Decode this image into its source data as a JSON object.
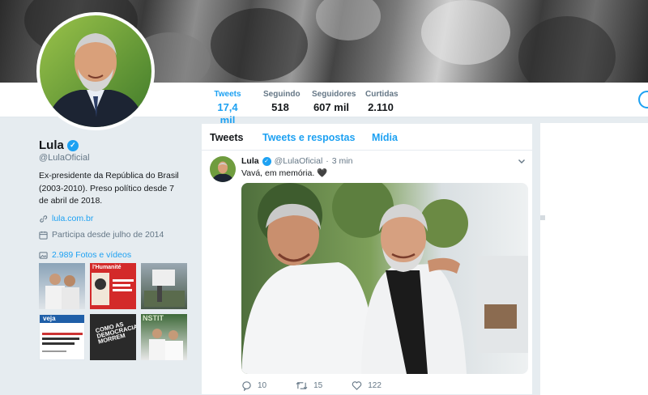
{
  "nav": {
    "stats": [
      {
        "label": "Tweets",
        "value": "17,4 mil",
        "active": true
      },
      {
        "label": "Seguindo",
        "value": "518"
      },
      {
        "label": "Seguidores",
        "value": "607 mil"
      },
      {
        "label": "Curtidas",
        "value": "2.110"
      }
    ]
  },
  "profile": {
    "name": "Lula",
    "handle": "@LulaOficial",
    "bio": "Ex-presidente da República do Brasil (2003-2010). Preso político desde 7 de abril de 2018.",
    "website": "lula.com.br",
    "joined": "Participa desde julho de 2014",
    "photos_label": "2.989 Fotos e vídeos",
    "thumbs": [
      {
        "text": ""
      },
      {
        "text": "l'Humanité"
      },
      {
        "text": ""
      },
      {
        "text": "veja"
      },
      {
        "text": "COMO AS DEMOCRACIAS MORREM"
      },
      {
        "text": "NSTIT"
      }
    ]
  },
  "timeline": {
    "tabs": [
      "Tweets",
      "Tweets e respostas",
      "Mídia"
    ],
    "tweet": {
      "name": "Lula",
      "handle": "@LulaOficial",
      "separator": "·",
      "time": "3 min",
      "text": "Vavá, em memória. 🖤",
      "replies": "10",
      "retweets": "15",
      "likes": "122"
    }
  },
  "colors": {
    "accent": "#1da1f2",
    "text": "#14171a",
    "muted": "#657786",
    "background": "#e6ecf0"
  }
}
